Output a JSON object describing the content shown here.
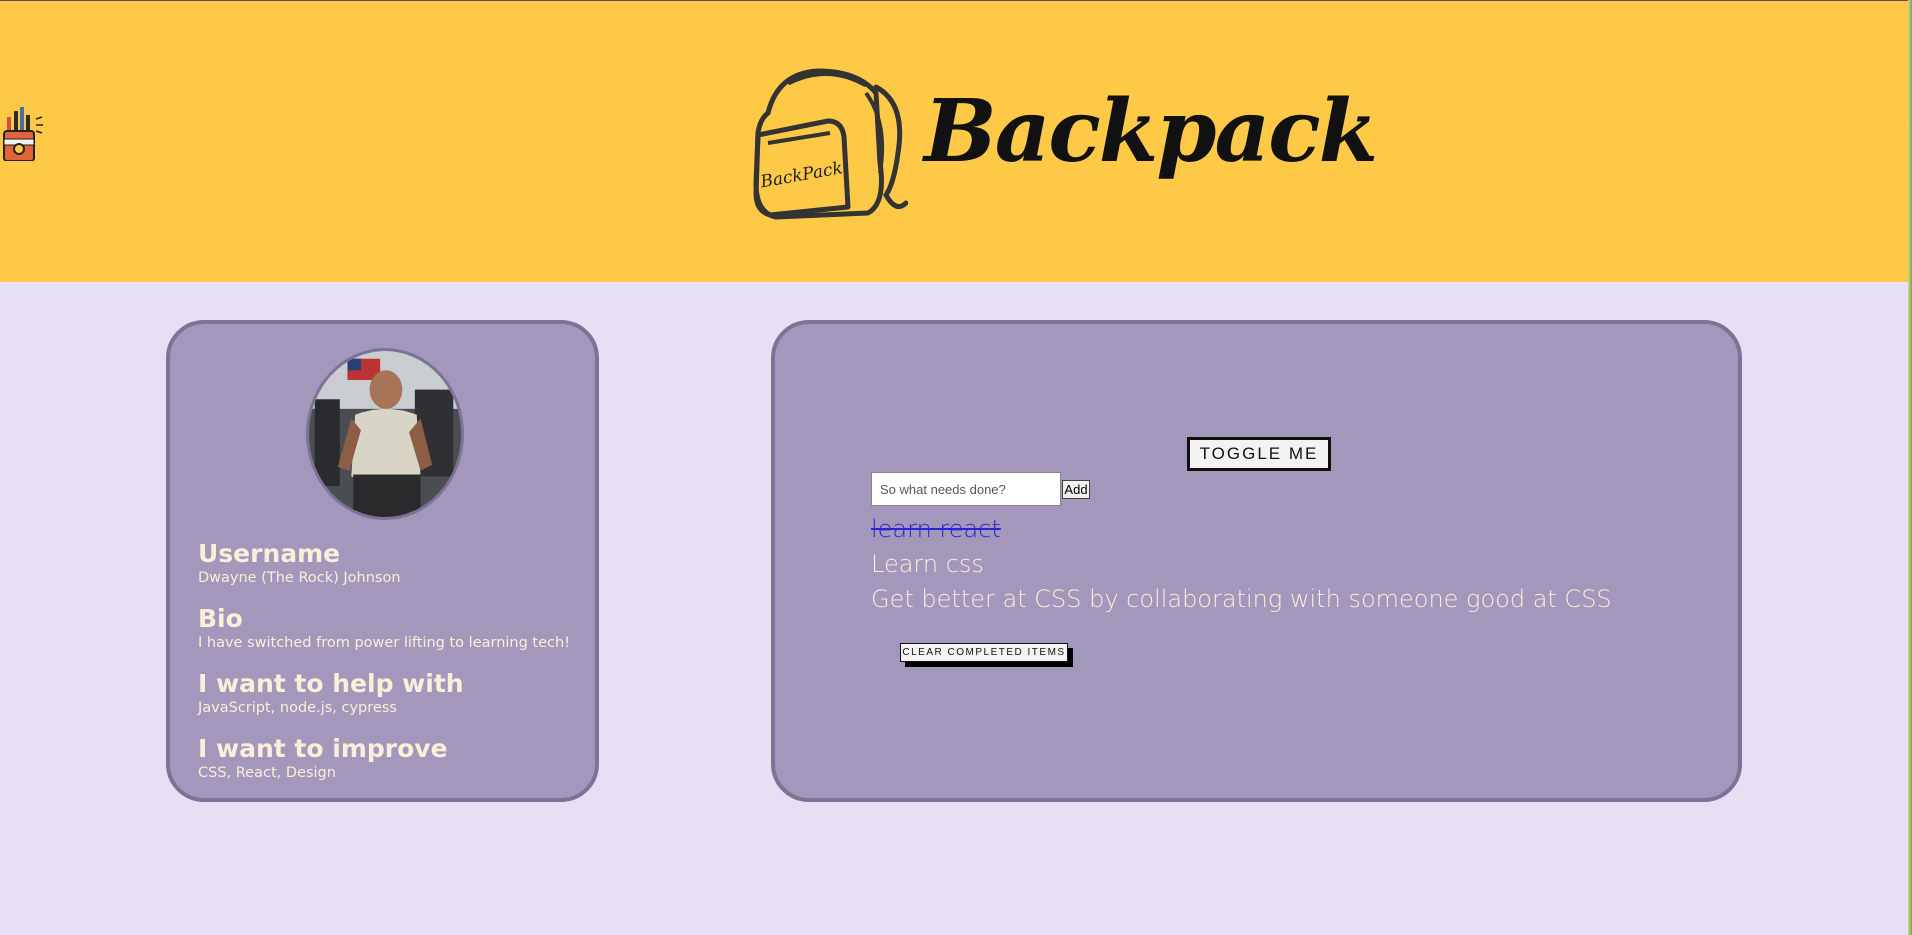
{
  "header": {
    "app_title": "Backpack",
    "logo_icon": "backpack-icon",
    "logo_icon_text": "BackPack",
    "side_icon": "pencil-cup-icon",
    "background_color": "#fec947"
  },
  "profile": {
    "avatar_icon": "avatar",
    "sections": [
      {
        "heading": "Username",
        "value": "Dwayne (The Rock) Johnson"
      },
      {
        "heading": "Bio",
        "value": "I have switched from power lifting to learning tech!"
      },
      {
        "heading": "I want to help with",
        "value": "JavaScript, node.js, cypress"
      },
      {
        "heading": "I want to improve",
        "value": "CSS, React, Design"
      }
    ]
  },
  "todo": {
    "toggle_label": "TOGGLE ME",
    "input_placeholder": "So what needs done?",
    "input_value": "",
    "add_label": "Add",
    "items": [
      {
        "text": "learn react",
        "completed": true
      },
      {
        "text": "Learn css",
        "completed": false
      },
      {
        "text": "Get better at CSS by collaborating with someone good at CSS",
        "completed": false
      }
    ],
    "clear_label": "CLEAR COMPLETED ITEMS"
  },
  "colors": {
    "page_background": "#e7dff4",
    "card_background": "#a398bb",
    "card_border": "#7d7399",
    "text_light": "#fbefd9",
    "completed_text": "#2a24d4"
  }
}
